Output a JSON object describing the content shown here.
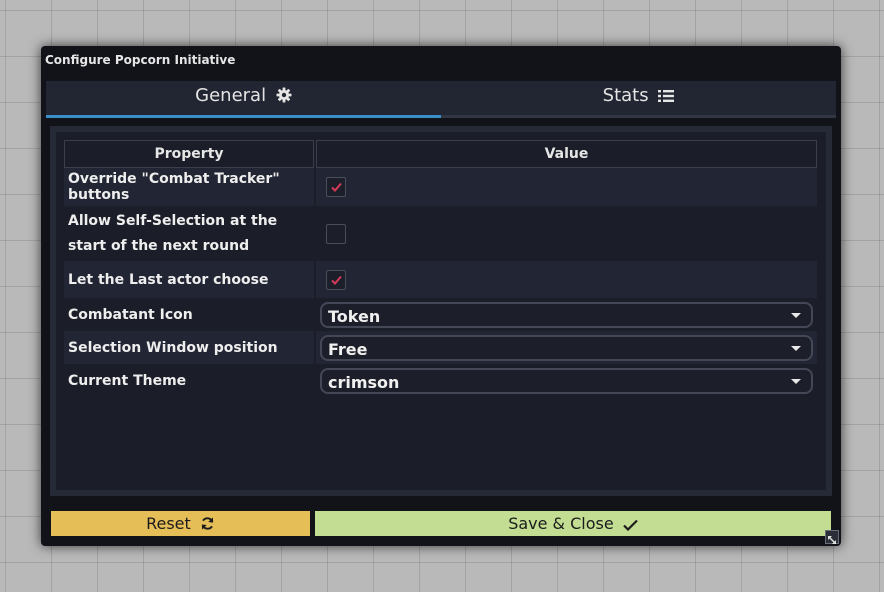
{
  "dialog": {
    "title": "Configure Popcorn Initiative"
  },
  "tabs": [
    {
      "label": "General",
      "icon": "gear-icon",
      "active": true
    },
    {
      "label": "Stats",
      "icon": "list-icon",
      "active": false
    }
  ],
  "table": {
    "headers": {
      "property": "Property",
      "value": "Value"
    },
    "rows": [
      {
        "label": "Override \"Combat Tracker\" buttons",
        "type": "checkbox",
        "checked": true
      },
      {
        "label": "Allow Self-Selection at the start of the next round",
        "type": "checkbox",
        "checked": false
      },
      {
        "label": "Let the Last actor choose",
        "type": "checkbox",
        "checked": true
      },
      {
        "label": "Combatant Icon",
        "type": "select",
        "value": "Token"
      },
      {
        "label": "Selection Window position",
        "type": "select",
        "value": "Free"
      },
      {
        "label": "Current Theme",
        "type": "select",
        "value": "crimson"
      }
    ]
  },
  "footer": {
    "reset_label": "Reset",
    "save_label": "Save & Close"
  },
  "colors": {
    "accent": "#3b8dc8",
    "check": "#d63a5a",
    "reset": "#e6be58",
    "save": "#c3de93"
  }
}
